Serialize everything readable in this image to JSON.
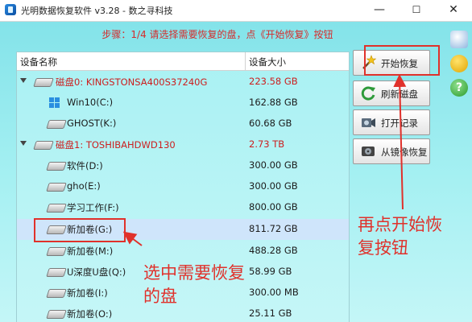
{
  "window": {
    "title": "光明数据恢复软件 v3.28 - 数之寻科技",
    "minimize": "—",
    "maximize": "☐",
    "close": "✕"
  },
  "step": "步骤：1/4 请选择需要恢复的盘，点《开始恢复》按钮",
  "device_list": {
    "headers": {
      "name": "设备名称",
      "size": "设备大小"
    },
    "rows": [
      {
        "name": "磁盘0: KINGSTONSA400S37240G",
        "size": "223.58 GB"
      },
      {
        "name": "Win10(C:)",
        "size": "162.88 GB"
      },
      {
        "name": "GHOST(K:)",
        "size": "60.68 GB"
      },
      {
        "name": "磁盘1: TOSHIBAHDWD130",
        "size": "2.73 TB"
      },
      {
        "name": "软件(D:)",
        "size": "300.00 GB"
      },
      {
        "name": "gho(E:)",
        "size": "300.00 GB"
      },
      {
        "name": "学习工作(F:)",
        "size": "800.00 GB"
      },
      {
        "name": "新加卷(G:)",
        "size": "811.72 GB"
      },
      {
        "name": "新加卷(M:)",
        "size": "488.28 GB"
      },
      {
        "name": "U深度U盘(Q:)",
        "size": "58.99 GB"
      },
      {
        "name": "新加卷(I:)",
        "size": "300.00 MB"
      },
      {
        "name": "新加卷(O:)",
        "size": "25.11 GB"
      }
    ]
  },
  "buttons": {
    "start": "开始恢复",
    "refresh": "刷新磁盘",
    "open_record": "打开记录",
    "from_image": "从镜像恢复"
  },
  "annotations": {
    "select_disk_line1": "选中需要恢复",
    "select_disk_line2": "的盘",
    "click_start_line1": "再点开始恢",
    "click_start_line2": "复按钮"
  },
  "colors": {
    "accent_red": "#e0312b",
    "background": "#a5f0f2",
    "selected_row": "#cfe5fb"
  }
}
